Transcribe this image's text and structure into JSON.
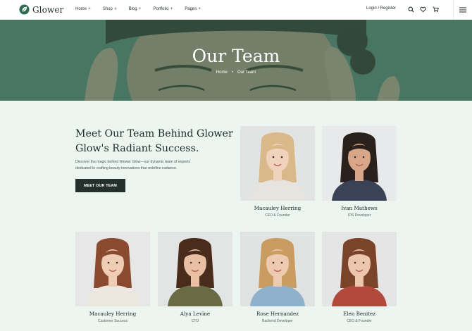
{
  "brand": {
    "name": "Glower",
    "accent": "#2e6b51"
  },
  "nav": [
    {
      "label": "Home"
    },
    {
      "label": "Shop"
    },
    {
      "label": "Blog"
    },
    {
      "label": "Portfolio"
    },
    {
      "label": "Pages"
    }
  ],
  "header": {
    "login_label": "Login / Register",
    "icons": [
      "search-icon",
      "heart-icon",
      "cart-icon",
      "menu-icon"
    ]
  },
  "hero": {
    "title": "Our Team",
    "breadcrumb": {
      "home": "Home",
      "current": "Our Team"
    }
  },
  "intro": {
    "title_line1": "Meet Our Team Behind Glower",
    "title_line2": "Glow's Radiant Success.",
    "desc_line1": "Discover the magic behind Glower Glow—our dynamic team of experts",
    "desc_line2": "dedicated to crafting beauty innovations that redefine radiance.",
    "button": "MEET OUR TEAM"
  },
  "team": [
    {
      "name": "Macauley Herring",
      "role": "CEO & Founder",
      "hair": "#d9b98a",
      "top": "#e7e4df",
      "skin": "#f0d2bd",
      "bg": "#e2e4e3"
    },
    {
      "name": "Ivan Mathews",
      "role": "IOS Developer",
      "hair": "#2b211c",
      "top": "#3a4256",
      "skin": "#d8a789",
      "bg": "#e8e9ea"
    },
    {
      "name": "Macauley Herring",
      "role": "Customer Success",
      "hair": "#8a4a2f",
      "top": "#ece8e0",
      "skin": "#efcdb5",
      "bg": "#e6e7e6"
    },
    {
      "name": "Alya Levine",
      "role": "CTO",
      "hair": "#4a2c1d",
      "top": "#6a6a45",
      "skin": "#e9c0a4",
      "bg": "#e3e4e4"
    },
    {
      "name": "Rose Hernandez",
      "role": "Backend Developer",
      "hair": "#c99d62",
      "top": "#8eb1cc",
      "skin": "#eecab1",
      "bg": "#e1e2e2"
    },
    {
      "name": "Elen Benitez",
      "role": "CEO & Founder",
      "hair": "#7b432a",
      "top": "#b2493d",
      "skin": "#ecc7ad",
      "bg": "#e5e5e5"
    }
  ]
}
